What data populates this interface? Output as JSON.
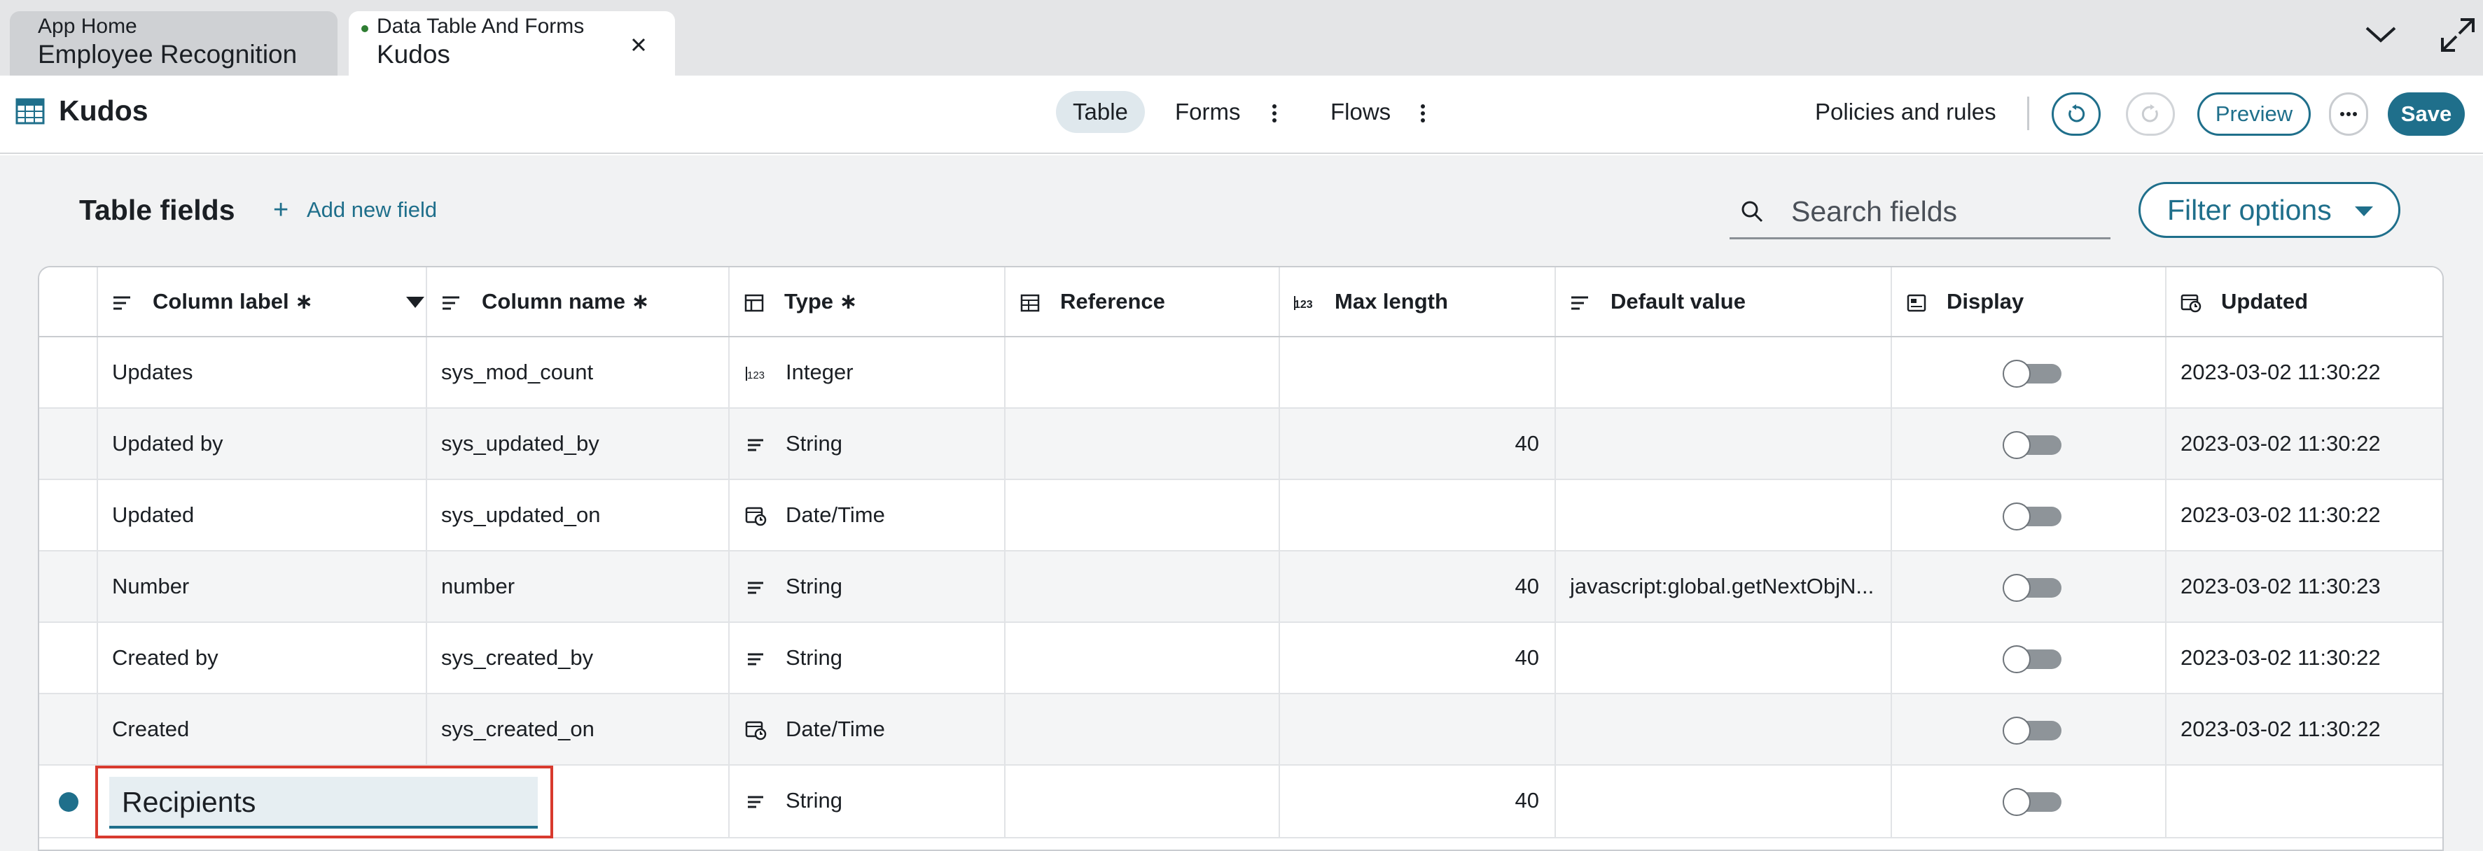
{
  "tabs": [
    {
      "subtitle": "App Home",
      "title": "Employee Recognition"
    },
    {
      "subtitle": "Data Table And Forms",
      "title": "Kudos"
    }
  ],
  "app": {
    "title": "Kudos"
  },
  "nav": {
    "table": "Table",
    "forms": "Forms",
    "flows": "Flows"
  },
  "actions": {
    "policies": "Policies and rules",
    "preview": "Preview",
    "save": "Save"
  },
  "section": {
    "title": "Table fields",
    "add_field": "Add new field"
  },
  "search": {
    "placeholder": "Search fields",
    "value": ""
  },
  "filter": {
    "label": "Filter options"
  },
  "columns": {
    "label": "Column label ∗",
    "name": "Column name ∗",
    "type": "Type ∗",
    "reference": "Reference",
    "max_length": "Max length",
    "default_value": "Default value",
    "display": "Display",
    "updated": "Updated"
  },
  "rows": [
    {
      "label": "Updates",
      "name": "sys_mod_count",
      "type": "Integer",
      "type_icon": "integer-icon",
      "max_length": "",
      "default_value": "",
      "display": false,
      "updated": "2023-03-02 11:30:22"
    },
    {
      "label": "Updated by",
      "name": "sys_updated_by",
      "type": "String",
      "type_icon": "string-icon",
      "max_length": "40",
      "default_value": "",
      "display": false,
      "updated": "2023-03-02 11:30:22"
    },
    {
      "label": "Updated",
      "name": "sys_updated_on",
      "type": "Date/Time",
      "type_icon": "datetime-icon",
      "max_length": "",
      "default_value": "",
      "display": false,
      "updated": "2023-03-02 11:30:22"
    },
    {
      "label": "Number",
      "name": "number",
      "type": "String",
      "type_icon": "string-icon",
      "max_length": "40",
      "default_value": "javascript:global.getNextObjN...",
      "display": false,
      "updated": "2023-03-02 11:30:23"
    },
    {
      "label": "Created by",
      "name": "sys_created_by",
      "type": "String",
      "type_icon": "string-icon",
      "max_length": "40",
      "default_value": "",
      "display": false,
      "updated": "2023-03-02 11:30:22"
    },
    {
      "label": "Created",
      "name": "sys_created_on",
      "type": "Date/Time",
      "type_icon": "datetime-icon",
      "max_length": "",
      "default_value": "",
      "display": false,
      "updated": "2023-03-02 11:30:22"
    }
  ],
  "new_row": {
    "label_value": "Recipients",
    "type": "String",
    "type_icon": "string-icon",
    "max_length": "40",
    "display": false
  },
  "colors": {
    "accent": "#1f6f8b",
    "highlight": "#d83a2e"
  }
}
